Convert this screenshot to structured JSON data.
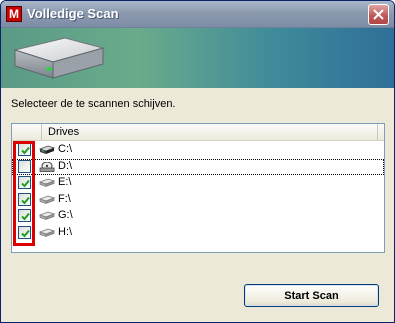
{
  "window": {
    "title": "Volledige Scan",
    "app_icon_letter": "M"
  },
  "prompt": "Selecteer de te scannen schijven.",
  "list": {
    "column_header": "Drives",
    "drives": [
      {
        "label": "C:\\",
        "checked": true,
        "icon": "system-drive-icon"
      },
      {
        "label": "D:\\",
        "checked": false,
        "icon": "cd-drive-icon",
        "focused": true
      },
      {
        "label": "E:\\",
        "checked": true,
        "icon": "drive-icon"
      },
      {
        "label": "F:\\",
        "checked": true,
        "icon": "drive-icon"
      },
      {
        "label": "G:\\",
        "checked": true,
        "icon": "drive-icon"
      },
      {
        "label": "H:\\",
        "checked": true,
        "icon": "drive-icon"
      }
    ]
  },
  "buttons": {
    "start_scan": "Start Scan"
  },
  "colors": {
    "highlight": "#dd0000",
    "check": "#21a121"
  }
}
